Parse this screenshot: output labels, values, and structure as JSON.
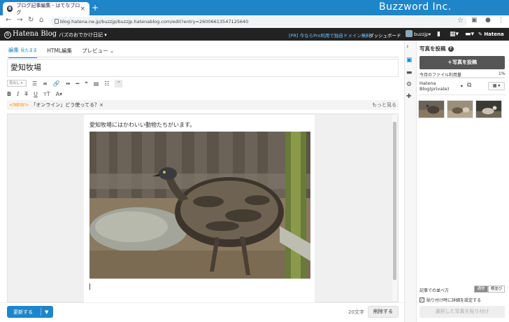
{
  "browser": {
    "tab_title": "ブログ記事編集 - はてなブログ",
    "brand": "Buzzword Inc.",
    "url": "blog.hatena.ne.jp/buzzjp/buzzjp.hatenablog.com/edit?entry=26006613547125640"
  },
  "header": {
    "logo": "Hatena Blog",
    "blog_name": "バズのおでかけ日記",
    "pro_text": "[PR] 今ならPro利用で独自ドメイン無料",
    "dashboard": "ダッシュボード",
    "user": "buzzjp",
    "service": "Hatena"
  },
  "editor": {
    "tabs": [
      {
        "label": "編集",
        "sub": "見たまま"
      },
      {
        "label": "HTML編集"
      },
      {
        "label": "プレビュー"
      }
    ],
    "title": "愛知牧場",
    "heading_select": "見出し",
    "notice_new": "<NEW>",
    "notice_text": "「オンライン」どう使ってる？×",
    "notice_more": "もっと見る",
    "body_text": "愛知牧場にはかわいい動物たちがいます。",
    "update_label": "更新する",
    "char_count": "20文字",
    "delete_label": "削除する"
  },
  "panel": {
    "title": "写真を投稿",
    "upload_label": "＋写真を投稿",
    "usage_label": "今月のファイル利用量",
    "usage_value": "1%",
    "album": "Hatena Blog(private)",
    "order_label": "記事での並べ方",
    "order_options": [
      "通常",
      "横並び"
    ],
    "detail_checkbox": "貼り付け時に詳細を設定する",
    "paste_label": "選択した写真を貼り付け"
  },
  "colors": {
    "accent": "#1f85c9",
    "header": "#222222",
    "notice_new": "#f39800"
  }
}
